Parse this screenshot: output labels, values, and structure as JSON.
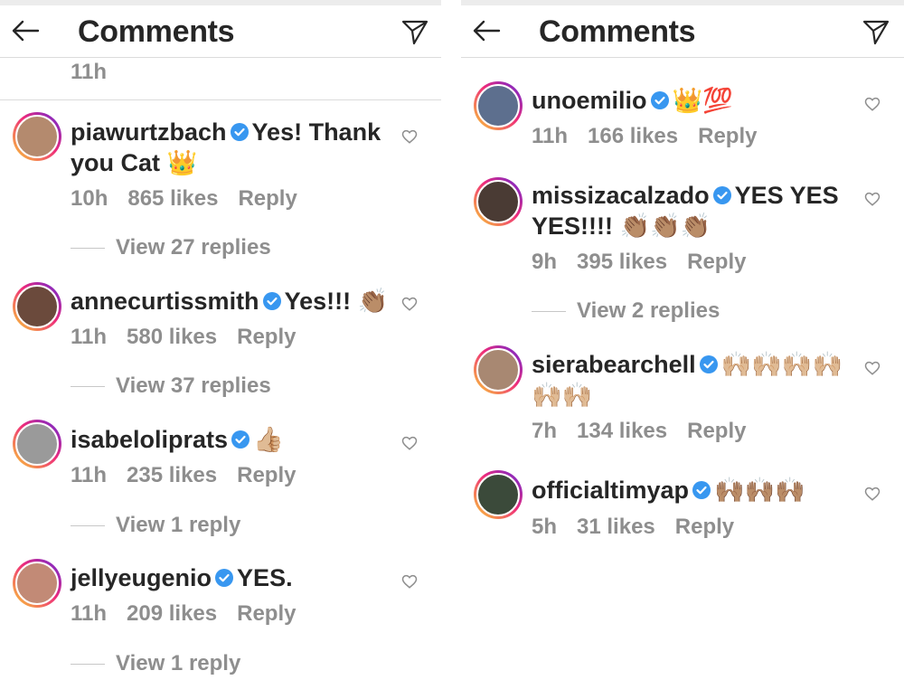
{
  "header": {
    "title": "Comments",
    "back_icon": "back-arrow-icon",
    "send_icon": "paper-plane-icon"
  },
  "left": {
    "top_time": "11h",
    "comments": [
      {
        "username": "piawurtzbach",
        "verified": true,
        "text": "Yes! Thank you Cat 👑",
        "time": "10h",
        "likes": "865 likes",
        "reply": "Reply",
        "view_replies": "View 27 replies",
        "avatar_color": "#b48a6e"
      },
      {
        "username": "annecurtissmith",
        "verified": true,
        "text": "Yes!!! 👏🏽",
        "time": "11h",
        "likes": "580 likes",
        "reply": "Reply",
        "view_replies": "View 37 replies",
        "avatar_color": "#6b4a3c"
      },
      {
        "username": "isabeloliprats",
        "verified": true,
        "text": "👍🏼",
        "time": "11h",
        "likes": "235 likes",
        "reply": "Reply",
        "view_replies": "View 1 reply",
        "avatar_color": "#9a9a9a"
      },
      {
        "username": "jellyeugenio",
        "verified": true,
        "text": "YES.",
        "time": "11h",
        "likes": "209 likes",
        "reply": "Reply",
        "view_replies": "View 1 reply",
        "avatar_color": "#c28a76"
      }
    ]
  },
  "right": {
    "comments": [
      {
        "username": "unoemilio",
        "verified": true,
        "text": "👑💯",
        "time": "11h",
        "likes": "166 likes",
        "reply": "Reply",
        "avatar_color": "#5d6f8e"
      },
      {
        "username": "missizacalzado",
        "verified": true,
        "text": "YES YES YES!!!! 👏🏽👏🏽👏🏽",
        "time": "9h",
        "likes": "395 likes",
        "reply": "Reply",
        "view_replies": "View 2 replies",
        "avatar_color": "#4a3b34"
      },
      {
        "username": "sierabearchell",
        "verified": true,
        "text": "🙌🏼🙌🏼🙌🏼🙌🏼🙌🏼🙌🏼",
        "time": "7h",
        "likes": "134 likes",
        "reply": "Reply",
        "avatar_color": "#a88872"
      },
      {
        "username": "officialtimyap",
        "verified": true,
        "text": "🙌🏽🙌🏽🙌🏽",
        "time": "5h",
        "likes": "31 likes",
        "reply": "Reply",
        "avatar_color": "#3b4a3a"
      }
    ]
  },
  "colors": {
    "text": "#262626",
    "muted": "#8e8e8e",
    "verified": "#3897f0",
    "divider": "#dbdbdb"
  }
}
